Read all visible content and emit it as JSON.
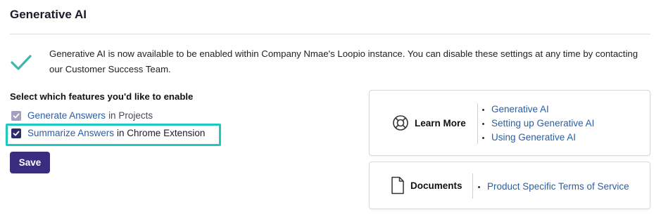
{
  "page": {
    "title": "Generative AI"
  },
  "notice": {
    "message": "Generative AI is now available to be enabled within Company Nmae's Loopio instance. You can disable these settings at any time by contacting our Customer Success Team.",
    "icon": "checkmark-icon",
    "icon_color": "#3fb6a8"
  },
  "features": {
    "heading": "Select which features you'd like to enable",
    "options": [
      {
        "link": "Generate Answers",
        "suffix": "in Projects",
        "checked": true,
        "disabled": true
      },
      {
        "link": "Summarize Answers",
        "suffix": "in Chrome Extension",
        "checked": true,
        "disabled": false
      }
    ],
    "highlight_color": "#1ec8c0"
  },
  "actions": {
    "save_label": "Save",
    "save_color": "#3a2d7f"
  },
  "learn_more": {
    "title": "Learn More",
    "icon": "lifebuoy-icon",
    "links": [
      "Generative AI",
      "Setting up Generative AI",
      "Using Generative AI"
    ]
  },
  "documents": {
    "title": "Documents",
    "icon": "document-icon",
    "links": [
      "Product Specific Terms of Service"
    ]
  },
  "colors": {
    "link": "#2a5ea5"
  }
}
